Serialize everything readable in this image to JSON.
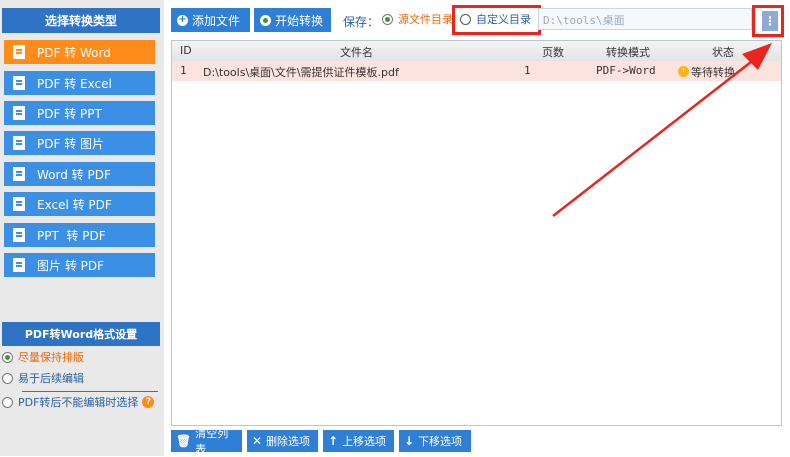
{
  "sidebar": {
    "header": "选择转换类型",
    "types": [
      {
        "label": "PDF 转 Word",
        "active": true
      },
      {
        "label": "PDF 转 Excel",
        "active": false
      },
      {
        "label": "PDF 转 PPT",
        "active": false
      },
      {
        "label": "PDF 转 图片",
        "active": false
      },
      {
        "label": "Word 转 PDF",
        "active": false
      },
      {
        "label": "Excel 转 PDF",
        "active": false
      },
      {
        "label": "PPT  转 PDF",
        "active": false
      },
      {
        "label": "图片 转 PDF",
        "active": false
      }
    ],
    "settings_header": "PDF转Word格式设置",
    "options": [
      {
        "label": "尽量保持排版",
        "selected": true
      },
      {
        "label": "易于后续编辑",
        "selected": false
      },
      {
        "label": "PDF转后不能编辑时选择",
        "selected": false
      }
    ],
    "help_glyph": "?"
  },
  "toolbar": {
    "add_file": "添加文件",
    "start_convert": "开始转换",
    "save_label": "保存：",
    "save_options": [
      {
        "label": "源文件目录",
        "selected": true
      },
      {
        "label": "自定义目录",
        "selected": false
      }
    ],
    "path_value": "D:\\tools\\桌面",
    "browse_glyph": "⋮"
  },
  "table": {
    "columns": [
      "ID",
      "文件名",
      "页数",
      "转换模式",
      "状态"
    ],
    "rows": [
      {
        "id": "1",
        "filename": "D:\\tools\\桌面\\文件\\需提供证件模板.pdf",
        "pages": "1",
        "mode": "PDF->Word",
        "status": "等待转换"
      }
    ]
  },
  "bottom": {
    "clear": "清空列表",
    "delete": "删除选项",
    "move_up": "上移选项",
    "move_down": "下移选项"
  },
  "colors": {
    "accent_blue": "#2f7fd6",
    "active_orange": "#ff8c1a",
    "annotation_red": "#e8261e"
  }
}
